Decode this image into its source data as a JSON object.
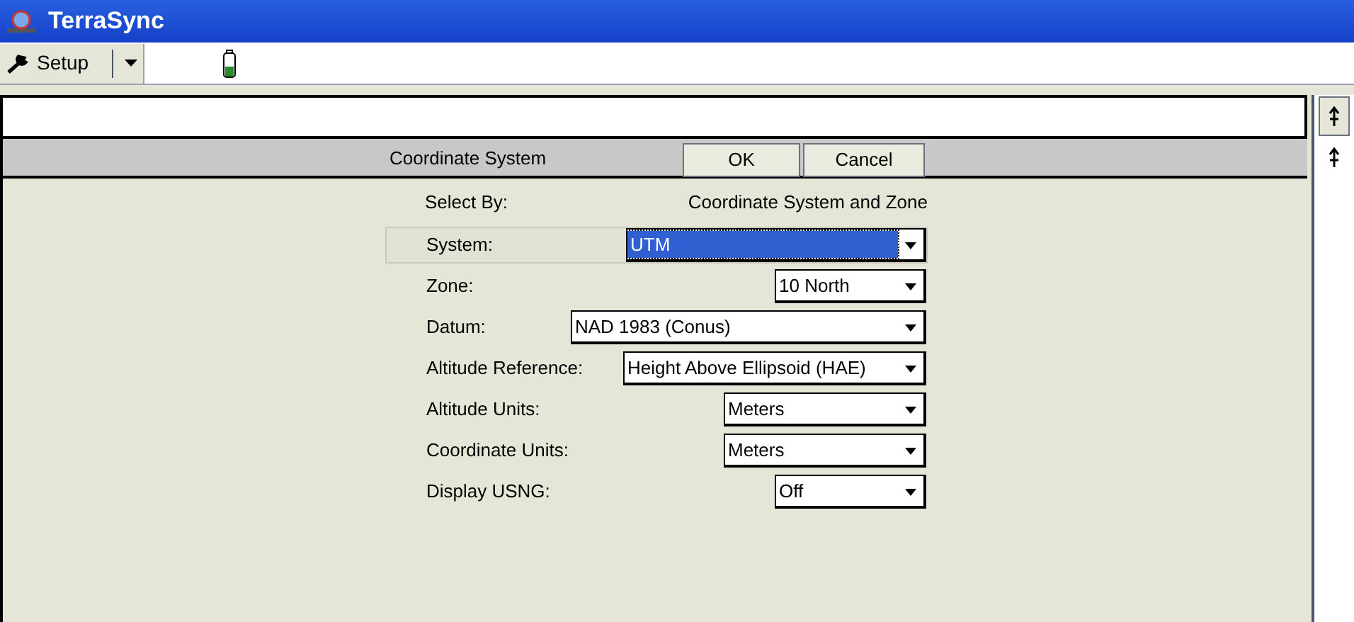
{
  "window": {
    "title": "TerraSync"
  },
  "toolbar": {
    "menu_button": "Setup"
  },
  "form": {
    "title": "Coordinate System",
    "buttons": [
      "OK",
      "Cancel"
    ],
    "select_by": {
      "label": "Select By:",
      "value": "Coordinate System and Zone"
    },
    "fields": [
      {
        "label": "System:",
        "value": "UTM",
        "focused": true
      },
      {
        "label": "Zone:",
        "value": "10 North",
        "focused": false
      },
      {
        "label": "Datum:",
        "value": "NAD 1983 (Conus)",
        "focused": false
      },
      {
        "label": "Altitude Reference:",
        "value": "Height Above Ellipsoid (HAE)",
        "focused": false
      },
      {
        "label": "Altitude Units:",
        "value": "Meters",
        "focused": false
      },
      {
        "label": "Coordinate Units:",
        "value": "Meters",
        "focused": false
      },
      {
        "label": "Display USNG:",
        "value": "Off",
        "focused": false
      }
    ]
  }
}
